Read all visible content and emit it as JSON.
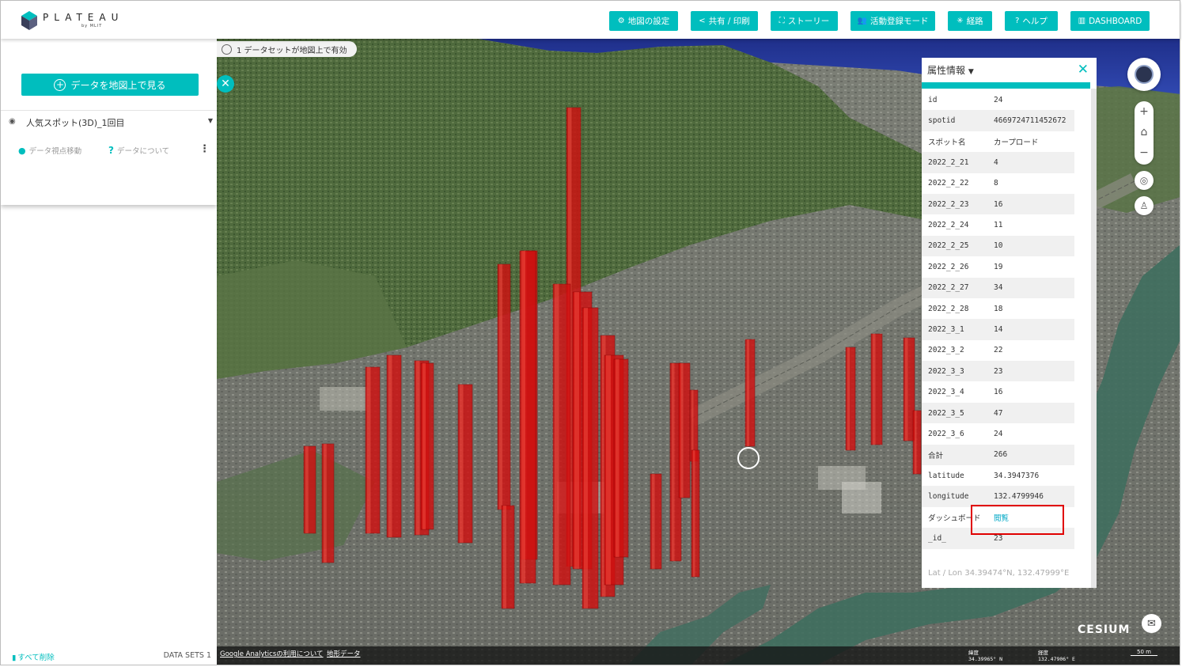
{
  "header": {
    "brand": "PLATEAU",
    "brand_sub": "by MLIT",
    "nav": [
      {
        "label": "地図の設定",
        "icon": "sliders-icon"
      },
      {
        "label": "共有 / 印刷",
        "icon": "share-icon"
      },
      {
        "label": "ストーリー",
        "icon": "story-icon"
      },
      {
        "label": "活動登録モード",
        "icon": "people-icon"
      },
      {
        "label": "経路",
        "icon": "route-icon"
      },
      {
        "label": "ヘルプ",
        "icon": "help-icon"
      },
      {
        "label": "DASHBOARD",
        "icon": "book-icon"
      }
    ]
  },
  "sidebar": {
    "add_button": "データを地図上で見る",
    "dataset_name": "人気スポット(3D)_1回目",
    "action_move": "データ視点移動",
    "action_about": "データについて",
    "clear_all": "すべて削除",
    "dataset_count": "DATA SETS 1"
  },
  "map": {
    "notice": "1 データセットが地図上で有効",
    "colors": {
      "accent": "#00bebe",
      "bar": "#d01010"
    },
    "bottom_links": [
      "Google Analyticsの利用について",
      "地形データ"
    ],
    "lat_label": "緯度",
    "lat_value": "34.39965° N",
    "lon_label": "経度",
    "lon_value": "132.47906° E",
    "scale": "50 m",
    "cesium": "CESIUM"
  },
  "attributes": {
    "title": "属性情報",
    "rows": [
      {
        "key": "id",
        "value": "24"
      },
      {
        "key": "spotid",
        "value": "4669724711452672"
      },
      {
        "key": "スポット名",
        "value": "カープロード"
      },
      {
        "key": "2022_2_21",
        "value": "4"
      },
      {
        "key": "2022_2_22",
        "value": "8"
      },
      {
        "key": "2022_2_23",
        "value": "16"
      },
      {
        "key": "2022_2_24",
        "value": "11"
      },
      {
        "key": "2022_2_25",
        "value": "10"
      },
      {
        "key": "2022_2_26",
        "value": "19"
      },
      {
        "key": "2022_2_27",
        "value": "34"
      },
      {
        "key": "2022_2_28",
        "value": "18"
      },
      {
        "key": "2022_3_1",
        "value": "14"
      },
      {
        "key": "2022_3_2",
        "value": "22"
      },
      {
        "key": "2022_3_3",
        "value": "23"
      },
      {
        "key": "2022_3_4",
        "value": "16"
      },
      {
        "key": "2022_3_5",
        "value": "47"
      },
      {
        "key": "2022_3_6",
        "value": "24"
      },
      {
        "key": "合計",
        "value": "266"
      },
      {
        "key": "latitude",
        "value": "34.3947376"
      },
      {
        "key": "longitude",
        "value": "132.4799946"
      },
      {
        "key": "ダッシュボード",
        "value": "閲覧"
      },
      {
        "key": "_id_",
        "value": "23"
      }
    ],
    "latlon": "Lat / Lon 34.39474°N, 132.47999°E"
  }
}
